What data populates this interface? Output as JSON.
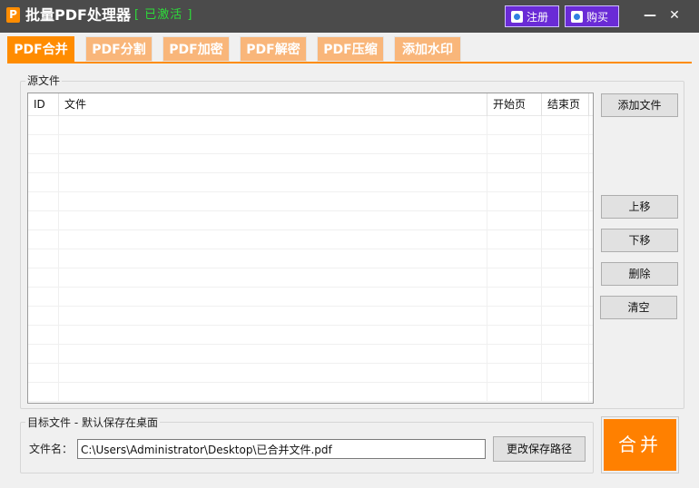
{
  "titlebar": {
    "app_icon_letter": "P",
    "title": "批量PDF处理器",
    "status": "[ 已激活 ]",
    "register_label": "注册",
    "buy_label": "购买",
    "minimize_glyph": "—",
    "close_glyph": "✕"
  },
  "tabs": [
    {
      "label": "PDF合并",
      "active": true
    },
    {
      "label": "PDF分割",
      "active": false
    },
    {
      "label": "PDF加密",
      "active": false
    },
    {
      "label": "PDF解密",
      "active": false
    },
    {
      "label": "PDF压缩",
      "active": false
    },
    {
      "label": "添加水印",
      "active": false
    }
  ],
  "source": {
    "group_label": "源文件",
    "columns": {
      "id": "ID",
      "file": "文件",
      "start": "开始页",
      "end": "结束页"
    },
    "rows": []
  },
  "buttons": {
    "add_file": "添加文件",
    "move_up": "上移",
    "move_down": "下移",
    "delete": "删除",
    "clear": "清空"
  },
  "target": {
    "group_label": "目标文件 - 默认保存在桌面",
    "file_label": "文件名：",
    "file_value": "C:\\Users\\Administrator\\Desktop\\已合并文件.pdf",
    "change_path_label": "更改保存路径",
    "merge_label": "合并"
  },
  "colors": {
    "accent": "#ff8c00",
    "tab_inactive": "#f9b67a",
    "titlebar": "#4b4b4b",
    "status_green": "#2ddc3a",
    "title_button": "#6a2bd6"
  }
}
